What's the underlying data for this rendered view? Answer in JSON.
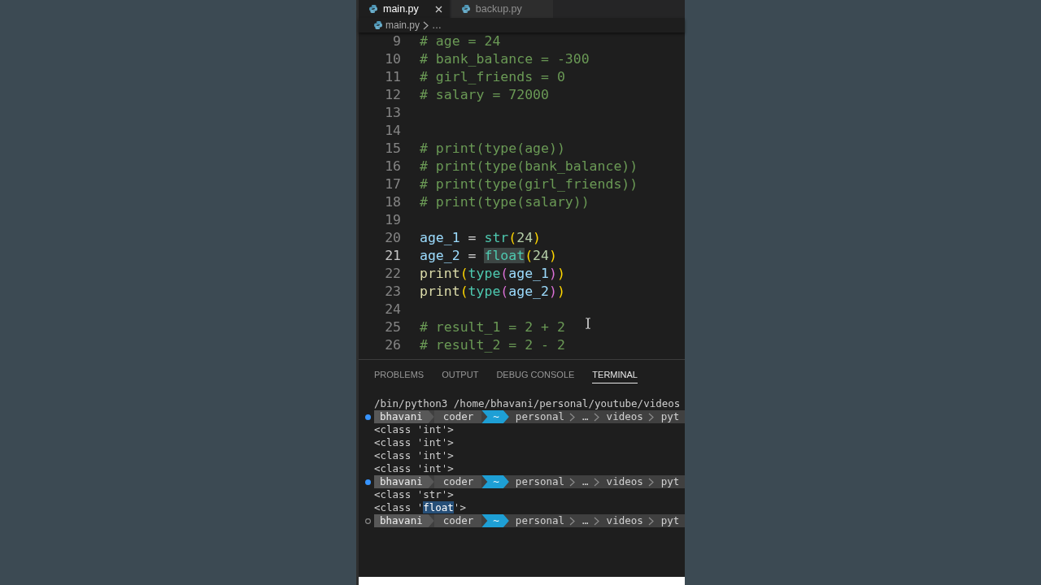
{
  "tabs": [
    {
      "label": "main.py",
      "selected": true
    },
    {
      "label": "backup.py",
      "selected": false
    }
  ],
  "breadcrumb": [
    "main.py",
    "…"
  ],
  "editor": {
    "lines": [
      {
        "number": "9",
        "current": false,
        "tokens": [
          {
            "text": "# age = 24",
            "kind": "comment",
            "highlighted": false
          }
        ]
      },
      {
        "number": "10",
        "current": false,
        "tokens": [
          {
            "text": "# bank_balance = -300",
            "kind": "comment",
            "highlighted": false
          }
        ]
      },
      {
        "number": "11",
        "current": false,
        "tokens": [
          {
            "text": "# girl_friends = 0",
            "kind": "comment",
            "highlighted": false
          }
        ]
      },
      {
        "number": "12",
        "current": false,
        "tokens": [
          {
            "text": "# salary = 72000",
            "kind": "comment",
            "highlighted": false
          }
        ]
      },
      {
        "number": "13",
        "current": false
      },
      {
        "number": "14",
        "current": false
      },
      {
        "number": "15",
        "current": false,
        "tokens": [
          {
            "text": "# print(type(age))",
            "kind": "comment",
            "highlighted": false
          }
        ]
      },
      {
        "number": "16",
        "current": false,
        "tokens": [
          {
            "text": "# print(type(bank_balance))",
            "kind": "comment",
            "highlighted": false
          }
        ]
      },
      {
        "number": "17",
        "current": false,
        "tokens": [
          {
            "text": "# print(type(girl_friends))",
            "kind": "comment",
            "highlighted": false
          }
        ]
      },
      {
        "number": "18",
        "current": false,
        "tokens": [
          {
            "text": "# print(type(salary))",
            "kind": "comment",
            "highlighted": false
          }
        ]
      },
      {
        "number": "19",
        "current": false
      },
      {
        "number": "20",
        "current": false,
        "tokens": [
          {
            "text": "age_1",
            "kind": "variable",
            "highlighted": false
          },
          {
            "text": " = ",
            "kind": "operator",
            "highlighted": false
          },
          {
            "text": "str",
            "kind": "class",
            "highlighted": false
          },
          {
            "text": "(",
            "kind": "bracket",
            "highlighted": false
          },
          {
            "text": "24",
            "kind": "number",
            "highlighted": false
          },
          {
            "text": ")",
            "kind": "bracket",
            "highlighted": false
          }
        ]
      },
      {
        "number": "21",
        "current": true,
        "tokens": [
          {
            "text": "age_2",
            "kind": "variable",
            "highlighted": false
          },
          {
            "text": " = ",
            "kind": "operator",
            "highlighted": false
          },
          {
            "text": "float",
            "kind": "class",
            "highlighted": true
          },
          {
            "text": "(",
            "kind": "bracket",
            "highlighted": false
          },
          {
            "text": "24",
            "kind": "number",
            "highlighted": false
          },
          {
            "text": ")",
            "kind": "bracket",
            "highlighted": false
          }
        ]
      },
      {
        "number": "22",
        "current": false,
        "tokens": [
          {
            "text": "print",
            "kind": "function",
            "highlighted": false
          },
          {
            "text": "(",
            "kind": "bracket",
            "highlighted": false
          },
          {
            "text": "type",
            "kind": "class",
            "highlighted": false
          },
          {
            "text": "(",
            "kind": "subbracket",
            "highlighted": false
          },
          {
            "text": "age_1",
            "kind": "variable",
            "highlighted": false
          },
          {
            "text": ")",
            "kind": "subbracket",
            "highlighted": false
          },
          {
            "text": ")",
            "kind": "bracket",
            "highlighted": false
          }
        ]
      },
      {
        "number": "23",
        "current": false,
        "tokens": [
          {
            "text": "print",
            "kind": "function",
            "highlighted": false
          },
          {
            "text": "(",
            "kind": "bracket",
            "highlighted": false
          },
          {
            "text": "type",
            "kind": "class",
            "highlighted": false
          },
          {
            "text": "(",
            "kind": "subbracket",
            "highlighted": false
          },
          {
            "text": "age_2",
            "kind": "variable",
            "highlighted": false
          },
          {
            "text": ")",
            "kind": "subbracket",
            "highlighted": false
          },
          {
            "text": ")",
            "kind": "bracket",
            "highlighted": false
          }
        ]
      },
      {
        "number": "24",
        "current": false
      },
      {
        "number": "25",
        "current": false,
        "tokens": [
          {
            "text": "# result_1 = 2 + 2",
            "kind": "comment",
            "highlighted": false
          }
        ]
      },
      {
        "number": "26",
        "current": false,
        "tokens": [
          {
            "text": "# result_2 = 2 - 2",
            "kind": "comment",
            "highlighted": false
          }
        ]
      }
    ]
  },
  "panel": {
    "tabs": [
      {
        "label": "PROBLEMS",
        "selected": false
      },
      {
        "label": "OUTPUT",
        "selected": false
      },
      {
        "label": "DEBUG CONSOLE",
        "selected": false
      },
      {
        "label": "TERMINAL",
        "selected": true
      }
    ],
    "terminal": {
      "lines": [
        {
          "kind": "text",
          "parts": [
            {
              "text": "/bin/python3 /home/bhavani/personal/youtube/videos",
              "selected": false
            }
          ]
        },
        {
          "kind": "prompt",
          "completed": true,
          "segments": [
            {
              "text": "bhavani",
              "kind": "user"
            },
            {
              "text": "coder",
              "kind": "host"
            },
            {
              "text": "~",
              "kind": "home"
            },
            {
              "text": "personal",
              "kind": "path"
            },
            {
              "text": "…",
              "kind": "path"
            },
            {
              "text": "videos",
              "kind": "path"
            },
            {
              "text": "pyt",
              "kind": "path"
            }
          ]
        },
        {
          "kind": "text",
          "parts": [
            {
              "text": "<class 'int'>",
              "selected": false
            }
          ]
        },
        {
          "kind": "text",
          "parts": [
            {
              "text": "<class 'int'>",
              "selected": false
            }
          ]
        },
        {
          "kind": "text",
          "parts": [
            {
              "text": "<class 'int'>",
              "selected": false
            }
          ]
        },
        {
          "kind": "text",
          "parts": [
            {
              "text": "<class 'int'>",
              "selected": false
            }
          ]
        },
        {
          "kind": "prompt",
          "completed": true,
          "segments": [
            {
              "text": "bhavani",
              "kind": "user"
            },
            {
              "text": "coder",
              "kind": "host"
            },
            {
              "text": "~",
              "kind": "home"
            },
            {
              "text": "personal",
              "kind": "path"
            },
            {
              "text": "…",
              "kind": "path"
            },
            {
              "text": "videos",
              "kind": "path"
            },
            {
              "text": "pyt",
              "kind": "path"
            }
          ]
        },
        {
          "kind": "text",
          "parts": [
            {
              "text": "<class 'str'>",
              "selected": false
            }
          ]
        },
        {
          "kind": "text",
          "parts": [
            {
              "text": "<class '",
              "selected": false
            },
            {
              "text": "float",
              "selected": true
            },
            {
              "text": "'>",
              "selected": false
            }
          ]
        },
        {
          "kind": "prompt",
          "completed": false,
          "segments": [
            {
              "text": "bhavani",
              "kind": "user"
            },
            {
              "text": "coder",
              "kind": "host"
            },
            {
              "text": "~",
              "kind": "home"
            },
            {
              "text": "personal",
              "kind": "path"
            },
            {
              "text": "…",
              "kind": "path"
            },
            {
              "text": "videos",
              "kind": "path"
            },
            {
              "text": "pyt",
              "kind": "path"
            }
          ]
        }
      ]
    }
  }
}
